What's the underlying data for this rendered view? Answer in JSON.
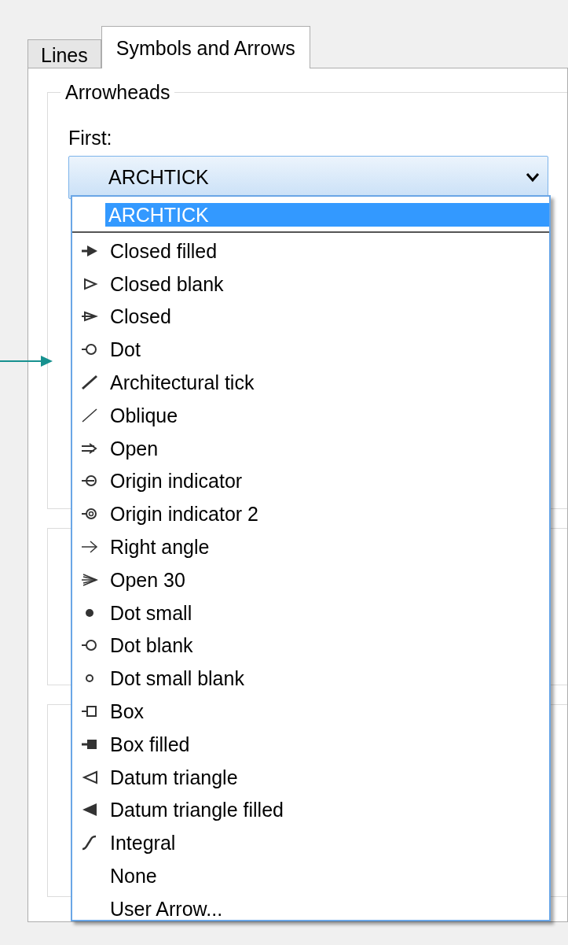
{
  "tabs": [
    {
      "label": "Lines",
      "selected": false
    },
    {
      "label": "Symbols and Arrows",
      "selected": true
    }
  ],
  "group": {
    "title": "Arrowheads",
    "field_label": "First:"
  },
  "combo": {
    "value": "ARCHTICK",
    "expanded": true
  },
  "options": [
    {
      "label": "ARCHTICK",
      "kind": "blank",
      "selected": true
    },
    {
      "label": "Closed filled",
      "kind": "closed-filled",
      "selected": false
    },
    {
      "label": "Closed blank",
      "kind": "closed-blank",
      "selected": false
    },
    {
      "label": "Closed",
      "kind": "closed",
      "selected": false
    },
    {
      "label": "Dot",
      "kind": "dot",
      "selected": false
    },
    {
      "label": "Architectural tick",
      "kind": "arch-tick",
      "selected": false
    },
    {
      "label": "Oblique",
      "kind": "oblique",
      "selected": false
    },
    {
      "label": "Open",
      "kind": "open",
      "selected": false
    },
    {
      "label": "Origin indicator",
      "kind": "origin",
      "selected": false
    },
    {
      "label": "Origin indicator 2",
      "kind": "origin2",
      "selected": false
    },
    {
      "label": "Right angle",
      "kind": "right-angle",
      "selected": false
    },
    {
      "label": "Open 30",
      "kind": "open30",
      "selected": false
    },
    {
      "label": "Dot small",
      "kind": "dot-small",
      "selected": false
    },
    {
      "label": "Dot blank",
      "kind": "dot-blank",
      "selected": false
    },
    {
      "label": "Dot small blank",
      "kind": "dot-small-blank",
      "selected": false
    },
    {
      "label": "Box",
      "kind": "box",
      "selected": false
    },
    {
      "label": "Box filled",
      "kind": "box-filled",
      "selected": false
    },
    {
      "label": "Datum triangle",
      "kind": "datum",
      "selected": false
    },
    {
      "label": "Datum triangle filled",
      "kind": "datum-filled",
      "selected": false
    },
    {
      "label": "Integral",
      "kind": "integral",
      "selected": false
    },
    {
      "label": "None",
      "kind": "none",
      "selected": false
    },
    {
      "label": "User Arrow...",
      "kind": "none",
      "selected": false
    }
  ]
}
